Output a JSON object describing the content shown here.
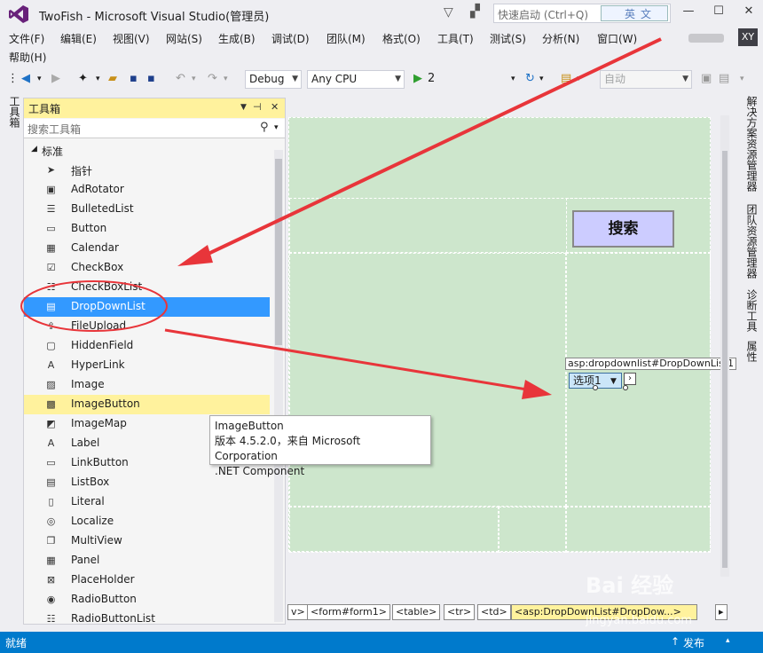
{
  "window": {
    "title": "TwoFish - Microsoft Visual Studio(管理员)",
    "quick_launch_placeholder": "快速启动 (Ctrl+Q)",
    "ime_label": "英文",
    "avatar_initials": "XY"
  },
  "menu": {
    "items": [
      "文件(F)",
      "编辑(E)",
      "视图(V)",
      "网站(S)",
      "生成(B)",
      "调试(D)",
      "团队(M)",
      "格式(O)",
      "工具(T)",
      "测试(S)",
      "分析(N)",
      "窗口(W)"
    ],
    "help": "帮助(H)"
  },
  "toolbar": {
    "config": "Debug",
    "platform": "Any CPU",
    "run_label": "2",
    "auto_combo": "自动"
  },
  "left_tab": "工具箱",
  "toolbox": {
    "title": "工具箱",
    "search_placeholder": "搜索工具箱",
    "group": "标准",
    "items": [
      {
        "label": "指针",
        "icon": "pointer-icon",
        "glyph": "➤"
      },
      {
        "label": "AdRotator",
        "icon": "adrotator-icon",
        "glyph": "▣"
      },
      {
        "label": "BulletedList",
        "icon": "bulletedlist-icon",
        "glyph": "☰"
      },
      {
        "label": "Button",
        "icon": "button-icon",
        "glyph": "▭"
      },
      {
        "label": "Calendar",
        "icon": "calendar-icon",
        "glyph": "▦"
      },
      {
        "label": "CheckBox",
        "icon": "checkbox-icon",
        "glyph": "☑"
      },
      {
        "label": "CheckBoxList",
        "icon": "checkboxlist-icon",
        "glyph": "☷"
      },
      {
        "label": "DropDownList",
        "icon": "dropdownlist-icon",
        "glyph": "▤"
      },
      {
        "label": "FileUpload",
        "icon": "fileupload-icon",
        "glyph": "⇪"
      },
      {
        "label": "HiddenField",
        "icon": "hiddenfield-icon",
        "glyph": "▢"
      },
      {
        "label": "HyperLink",
        "icon": "hyperlink-icon",
        "glyph": "A"
      },
      {
        "label": "Image",
        "icon": "image-icon",
        "glyph": "▨"
      },
      {
        "label": "ImageButton",
        "icon": "imagebutton-icon",
        "glyph": "▩"
      },
      {
        "label": "ImageMap",
        "icon": "imagemap-icon",
        "glyph": "◩"
      },
      {
        "label": "Label",
        "icon": "label-icon",
        "glyph": "A"
      },
      {
        "label": "LinkButton",
        "icon": "linkbutton-icon",
        "glyph": "▭"
      },
      {
        "label": "ListBox",
        "icon": "listbox-icon",
        "glyph": "▤"
      },
      {
        "label": "Literal",
        "icon": "literal-icon",
        "glyph": "▯"
      },
      {
        "label": "Localize",
        "icon": "localize-icon",
        "glyph": "◎"
      },
      {
        "label": "MultiView",
        "icon": "multiview-icon",
        "glyph": "❐"
      },
      {
        "label": "Panel",
        "icon": "panel-icon",
        "glyph": "▦"
      },
      {
        "label": "PlaceHolder",
        "icon": "placeholder-icon",
        "glyph": "⊠"
      },
      {
        "label": "RadioButton",
        "icon": "radiobutton-icon",
        "glyph": "◉"
      },
      {
        "label": "RadioButtonList",
        "icon": "radiobuttonlist-icon",
        "glyph": "☷"
      }
    ],
    "selected_index": 7,
    "hover_index": 12
  },
  "tooltip": {
    "line1": "ImageButton",
    "line2": "版本 4.5.2.0，来自 Microsoft Corporation",
    "line3": ".NET Component"
  },
  "designer": {
    "search_button": "搜索",
    "ddl_tag": "asp:dropdownlist#DropDownList1",
    "ddl_value": "选项1"
  },
  "tagnav": [
    "<form#form1>",
    "<table>",
    "<tr>",
    "<td>",
    "<asp:DropDownList#DropDow...>"
  ],
  "right_tabs": [
    "解决方案资源管理器",
    "团队资源管理器",
    "诊断工具",
    "属性"
  ],
  "status": {
    "text": "就绪",
    "publish": "发布"
  },
  "colors": {
    "accent": "#007acc",
    "selection": "#3399ff",
    "highlight": "#fff29d",
    "canvas": "#cde6cc",
    "annotation": "#e8353a"
  }
}
